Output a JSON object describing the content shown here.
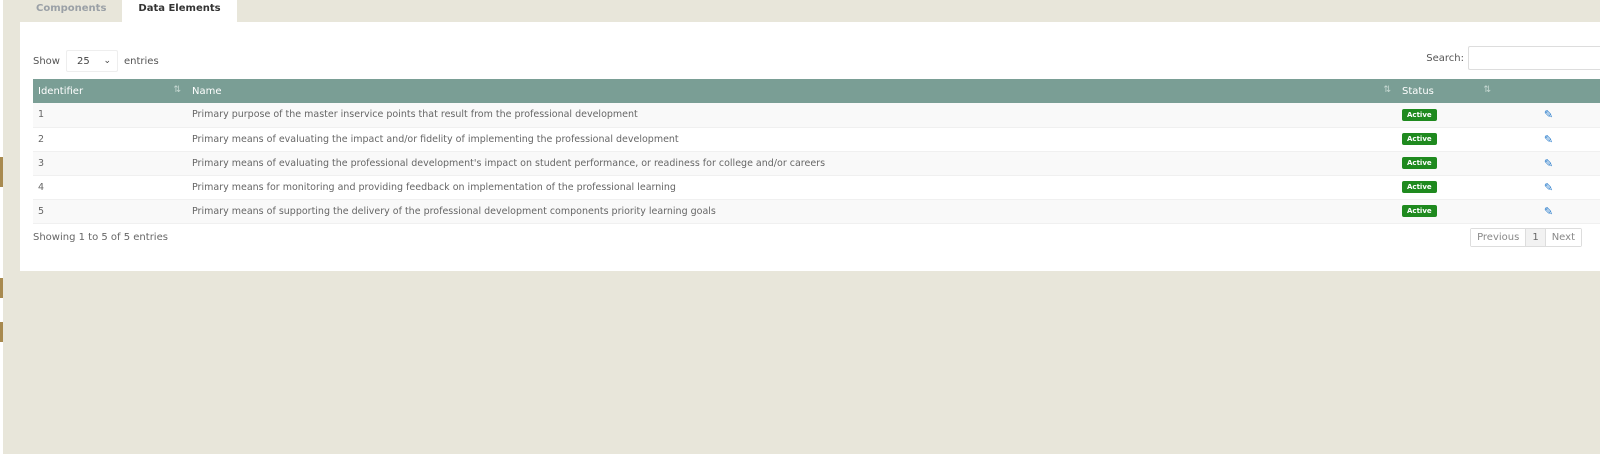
{
  "tabs": [
    {
      "label": "Components",
      "active": false
    },
    {
      "label": "Data Elements",
      "active": true
    }
  ],
  "controls": {
    "show_label": "Show",
    "page_length": "25",
    "entries_label": "entries",
    "search_label": "Search:",
    "search_value": ""
  },
  "table": {
    "columns": [
      "Identifier",
      "Name",
      "Status",
      ""
    ],
    "rows": [
      {
        "id": "1",
        "name": "Primary purpose of the master inservice points that result from the professional development",
        "status": "Active"
      },
      {
        "id": "2",
        "name": "Primary means of evaluating the impact and/or fidelity of implementing the professional development",
        "status": "Active"
      },
      {
        "id": "3",
        "name": "Primary means of evaluating the professional development's impact on student performance, or readiness for college and/or careers",
        "status": "Active"
      },
      {
        "id": "4",
        "name": "Primary means for monitoring and providing feedback on implementation of the professional learning",
        "status": "Active"
      },
      {
        "id": "5",
        "name": "Primary means of supporting the delivery of the professional development components priority learning goals",
        "status": "Active"
      }
    ]
  },
  "footer": {
    "info": "Showing 1 to 5 of 5 entries",
    "previous": "Previous",
    "page": "1",
    "next": "Next"
  },
  "colors": {
    "header_bg": "#7a9e95",
    "status_active": "#1f8a1f",
    "edit_icon": "#1a73c8",
    "page_bg": "#e8e6da"
  },
  "icons": {
    "sort": "sort-icon",
    "edit": "pencil-icon",
    "select": "chevron-down-icon"
  }
}
